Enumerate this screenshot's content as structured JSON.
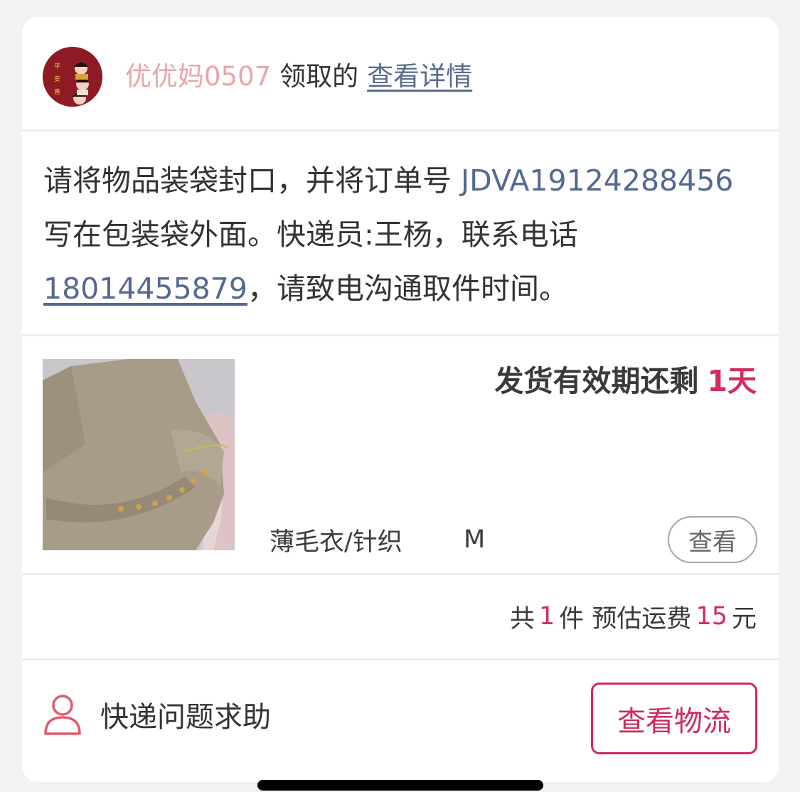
{
  "header": {
    "username": "优优妈0507",
    "action_text": "领取的",
    "detail_link": "查看详情"
  },
  "instructions": {
    "part1": "请将物品装袋封口，并将订单号 ",
    "order_number": "JDVA19124288456",
    "part2": " 写在包装袋外面。快递员:王杨，联系电话",
    "phone": "18014455879",
    "part3": "，请致电沟通取件时间。"
  },
  "item": {
    "validity_label": "发货有效期还剩",
    "validity_value": "1天",
    "category": "薄毛衣/针织",
    "size": "M",
    "view_button": "查看"
  },
  "summary": {
    "prefix": "共",
    "count": "1",
    "mid": "件 预估运费",
    "fee": "15",
    "unit": "元"
  },
  "footer": {
    "help_label": "快递问题求助",
    "logistics_button": "查看物流"
  },
  "colors": {
    "accent_red": "#d22d5f",
    "link_blue": "#55698f",
    "username_pink": "#e8a6a8"
  },
  "icons": {
    "help": "person-outline-icon"
  }
}
